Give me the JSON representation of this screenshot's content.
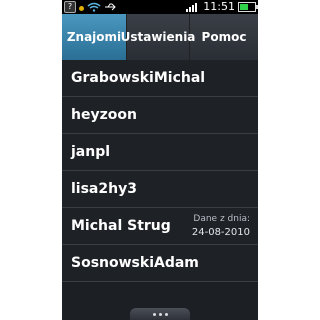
{
  "status_bar": {
    "time": "11:51",
    "battery_level": 0.6,
    "icons": [
      "question-icon",
      "notification-dot-icon",
      "wifi-icon",
      "usb-icon",
      "signal-icon",
      "battery-icon"
    ],
    "colors": {
      "battery": "#2fd24a"
    }
  },
  "tabs": [
    {
      "label": "Znajomi",
      "active": true
    },
    {
      "label": "Ustawienia",
      "active": false
    },
    {
      "label": "Pomoc",
      "active": false
    }
  ],
  "contacts": [
    {
      "name": "GrabowskiMichal"
    },
    {
      "name": "heyzoon"
    },
    {
      "name": "janpl"
    },
    {
      "name": "lisa2hy3"
    },
    {
      "name": "Michal Strug",
      "meta_label": "Dane z dnia:",
      "meta_date": "24-08-2010"
    },
    {
      "name": "SosnowskiAdam"
    }
  ],
  "colors": {
    "accent": "#3a86b0",
    "background": "#1c1f24",
    "text": "#ffffff"
  },
  "more_handle_icon": "more-dots-icon"
}
